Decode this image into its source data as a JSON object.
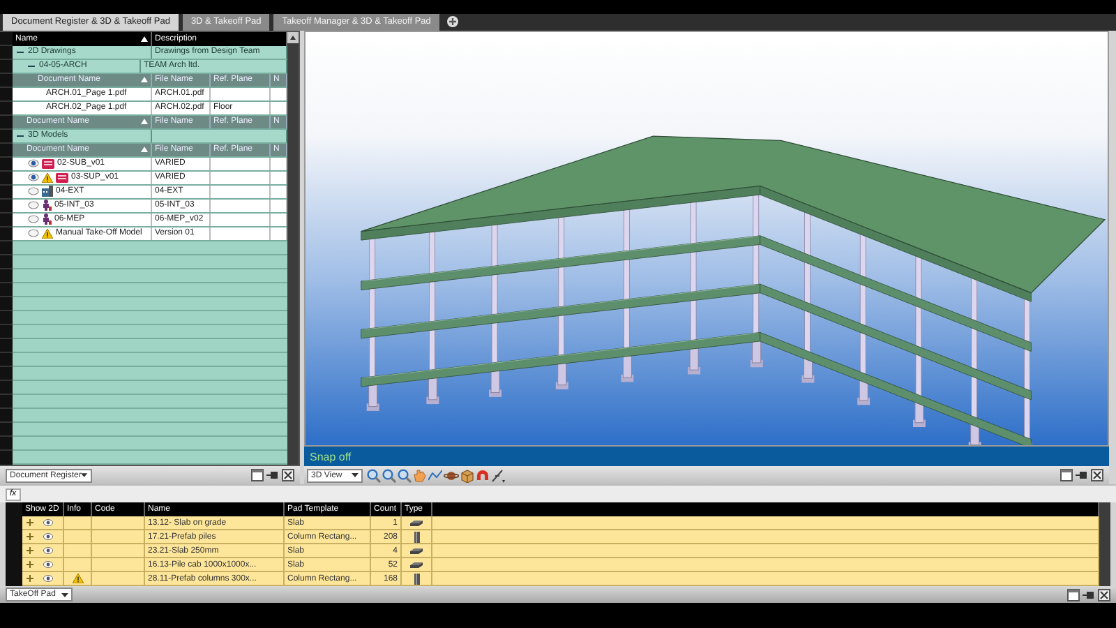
{
  "tabs": [
    {
      "label": "Document Register & 3D & Takeoff Pad",
      "selected": true
    },
    {
      "label": "3D & Takeoff Pad",
      "selected": false
    },
    {
      "label": "Takeoff Manager & 3D & Takeoff Pad",
      "selected": false
    }
  ],
  "document_register": {
    "columns": [
      "Name",
      "Description"
    ],
    "groups": [
      {
        "name": "2D Drawings",
        "description": "Drawings from Design Team",
        "expanded": true,
        "children": [
          {
            "name": "04-05-ARCH",
            "description": "TEAM Arch ltd.",
            "expanded": true,
            "columns": [
              "Document Name",
              "File Name",
              "Ref. Plane",
              "N"
            ],
            "rows": [
              {
                "name": "ARCH.01_Page 1.pdf",
                "file": "ARCH.01.pdf"
              },
              {
                "name": "ARCH.02_Page 1.pdf",
                "file": "ARCH.02.pdf",
                "ref_plane": "Floor"
              }
            ]
          }
        ],
        "columns": [
          "Document Name",
          "File Name",
          "Ref. Plane",
          "N"
        ]
      },
      {
        "name": "3D Models",
        "expanded": true,
        "columns": [
          "Document Name",
          "File Name",
          "Ref. Plane",
          "N"
        ],
        "rows": [
          {
            "name": "02-SUB_v01",
            "file": "VARIED",
            "visible": true,
            "warning": false,
            "kind": "stack"
          },
          {
            "name": "03-SUP_v01",
            "file": "VARIED",
            "visible": true,
            "warning": true,
            "kind": "stack"
          },
          {
            "name": "04-EXT",
            "file": "04-EXT",
            "visible": false,
            "warning": false,
            "kind": "building"
          },
          {
            "name": "05-INT_03",
            "file": "05-INT_03",
            "visible": false,
            "warning": false,
            "kind": "figure"
          },
          {
            "name": "06-MEP",
            "file": "06-MEP_v02",
            "visible": false,
            "warning": false,
            "kind": "figure"
          },
          {
            "name": "Manual Take-Off Model",
            "file": "Version 01",
            "visible": false,
            "warning": true,
            "kind": "none"
          }
        ]
      }
    ],
    "view_selector": "Document Register"
  },
  "viewer": {
    "snap": "Snap off",
    "view_selector": "3D View"
  },
  "takeoff": {
    "formula_label": "fx",
    "columns": [
      "Show 2D",
      "Info",
      "Code",
      "Name",
      "Pad Template",
      "Count",
      "Type"
    ],
    "rows": [
      {
        "name": "13.12- Slab on grade",
        "template": "Slab",
        "count": "1",
        "kind": "slab",
        "warning": false
      },
      {
        "name": "17.21-Prefab piles",
        "template": "Column Rectang...",
        "count": "208",
        "kind": "column",
        "warning": false
      },
      {
        "name": "23.21-Slab 250mm",
        "template": "Slab",
        "count": "4",
        "kind": "slab",
        "warning": false
      },
      {
        "name": "16.13-Pile cab 1000x1000x...",
        "template": "Slab",
        "count": "52",
        "kind": "slab",
        "warning": false
      },
      {
        "name": "28.11-Prefab columns 300x...",
        "template": "Column Rectang...",
        "count": "168",
        "kind": "column",
        "warning": true
      }
    ],
    "view_selector": "TakeOff Pad"
  }
}
